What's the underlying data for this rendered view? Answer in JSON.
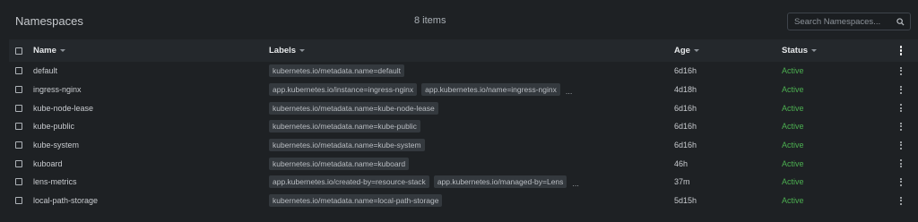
{
  "header": {
    "title": "Namespaces",
    "count": "8 items",
    "search": {
      "placeholder": "Search Namespaces...",
      "value": "",
      "icon": "search-icon"
    }
  },
  "table": {
    "columns": {
      "name": "Name",
      "labels": "Labels",
      "age": "Age",
      "status": "Status"
    },
    "rows": [
      {
        "name": "default",
        "labels": [
          "kubernetes.io/metadata.name=default"
        ],
        "more": false,
        "age": "6d16h",
        "status": "Active"
      },
      {
        "name": "ingress-nginx",
        "labels": [
          "app.kubernetes.io/instance=ingress-nginx",
          "app.kubernetes.io/name=ingress-nginx"
        ],
        "more": true,
        "age": "4d18h",
        "status": "Active"
      },
      {
        "name": "kube-node-lease",
        "labels": [
          "kubernetes.io/metadata.name=kube-node-lease"
        ],
        "more": false,
        "age": "6d16h",
        "status": "Active"
      },
      {
        "name": "kube-public",
        "labels": [
          "kubernetes.io/metadata.name=kube-public"
        ],
        "more": false,
        "age": "6d16h",
        "status": "Active"
      },
      {
        "name": "kube-system",
        "labels": [
          "kubernetes.io/metadata.name=kube-system"
        ],
        "more": false,
        "age": "6d16h",
        "status": "Active"
      },
      {
        "name": "kuboard",
        "labels": [
          "kubernetes.io/metadata.name=kuboard"
        ],
        "more": false,
        "age": "46h",
        "status": "Active"
      },
      {
        "name": "lens-metrics",
        "labels": [
          "app.kubernetes.io/created-by=resource-stack",
          "app.kubernetes.io/managed-by=Lens"
        ],
        "more": true,
        "age": "37m",
        "status": "Active"
      },
      {
        "name": "local-path-storage",
        "labels": [
          "kubernetes.io/metadata.name=local-path-storage"
        ],
        "more": false,
        "age": "5d15h",
        "status": "Active"
      }
    ]
  },
  "more_indicator": "...",
  "colors": {
    "background": "#1e2124",
    "header_background": "#24282c",
    "active_status": "#4caf50",
    "chip_background": "#34393e"
  }
}
